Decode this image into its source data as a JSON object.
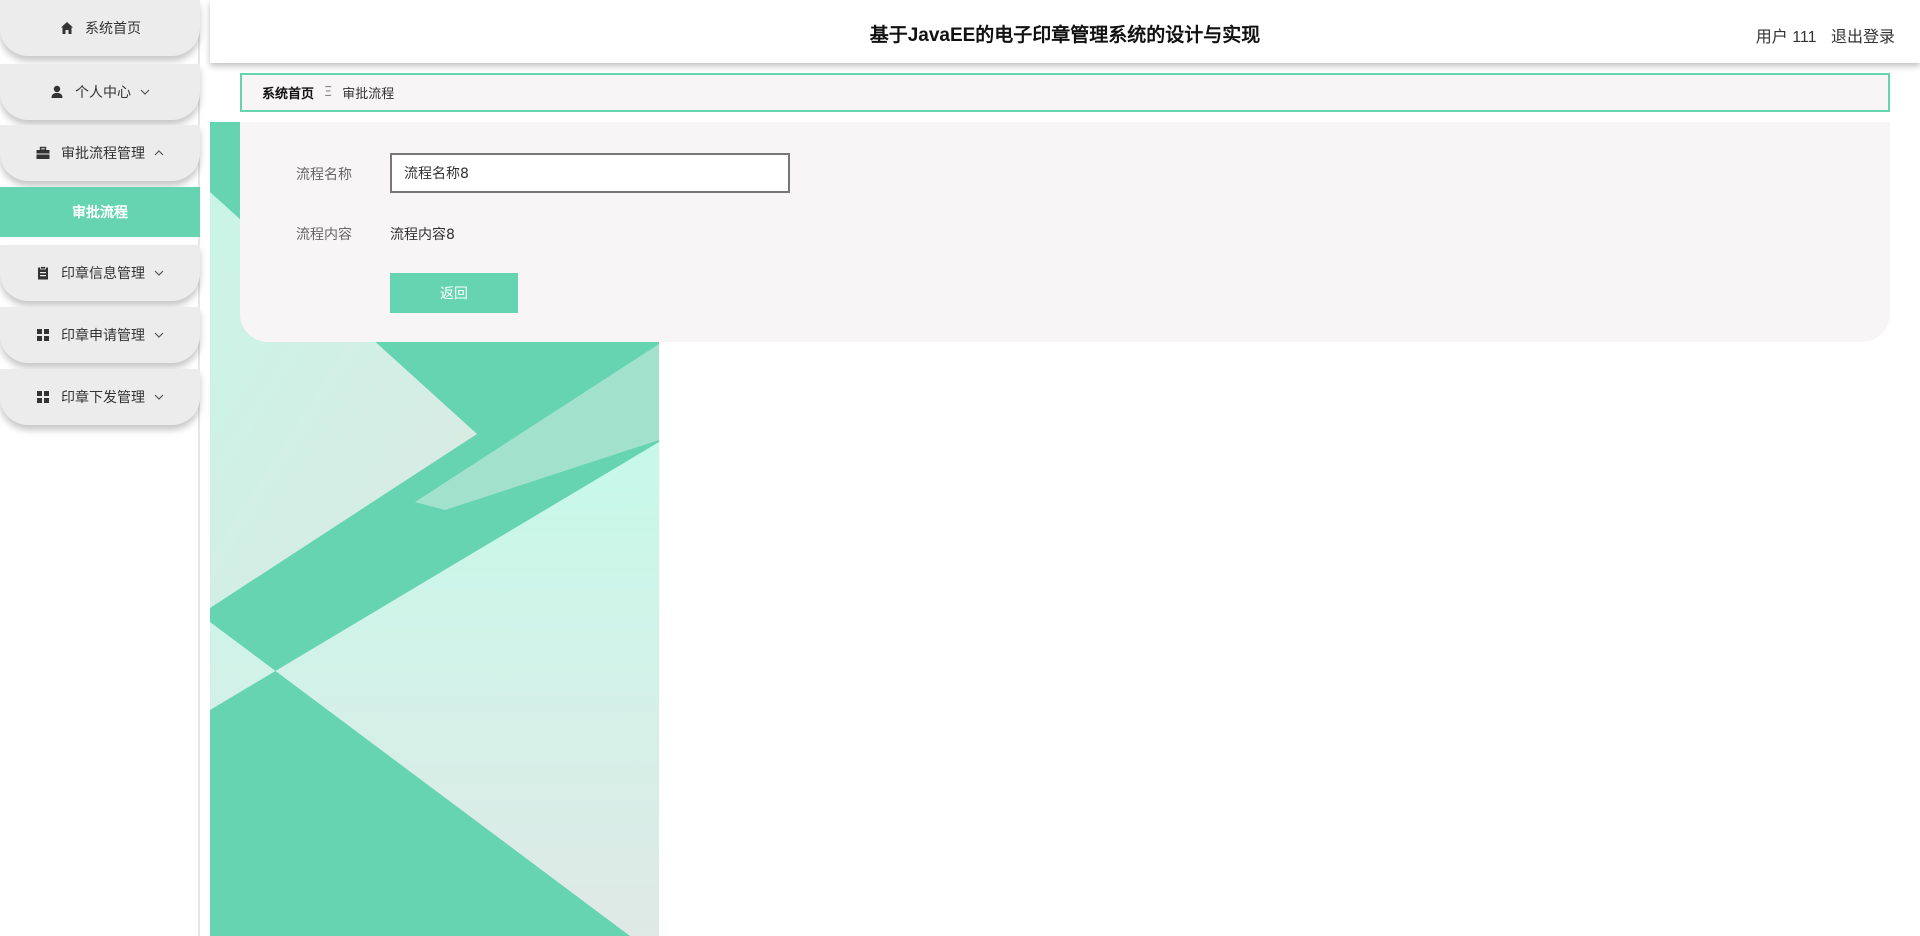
{
  "header": {
    "title": "基于JavaEE的电子印章管理系统的设计与实现",
    "user": "用户 111",
    "logout": "退出登录"
  },
  "sidebar": {
    "items": [
      {
        "label": "系统首页",
        "icon": "home-icon"
      },
      {
        "label": "个人中心",
        "icon": "user-icon",
        "expanded": false
      },
      {
        "label": "审批流程管理",
        "icon": "briefcase-icon",
        "expanded": true
      },
      {
        "label": "印章信息管理",
        "icon": "clipboard-icon",
        "expanded": false
      },
      {
        "label": "印章申请管理",
        "icon": "grid-icon",
        "expanded": false
      },
      {
        "label": "印章下发管理",
        "icon": "grid-icon",
        "expanded": false
      }
    ],
    "active_sub": "审批流程"
  },
  "breadcrumb": {
    "home": "系统首页",
    "separator": "Ξ",
    "current": "审批流程"
  },
  "form": {
    "name_label": "流程名称",
    "name_value": "流程名称8",
    "content_label": "流程内容",
    "content_value": "流程内容8",
    "back_button": "返回"
  },
  "colors": {
    "accent": "#66d4b1",
    "panel": "#f7f5f5",
    "menu": "#ececec"
  }
}
